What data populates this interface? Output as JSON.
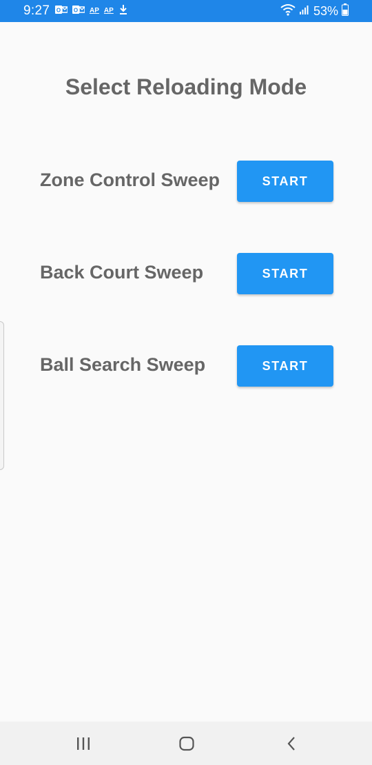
{
  "status_bar": {
    "time": "9:27",
    "notification_icons": [
      "outlook-icon",
      "outlook-icon",
      "ap-icon",
      "ap-icon",
      "download-icon"
    ],
    "ap_label": "AP",
    "battery_percent": "53%",
    "color": "#1f86e8"
  },
  "page": {
    "title": "Select Reloading Mode"
  },
  "modes": [
    {
      "label": "Zone Control Sweep",
      "button": "START"
    },
    {
      "label": "Back Court Sweep",
      "button": "START"
    },
    {
      "label": "Ball Search Sweep",
      "button": "START"
    }
  ],
  "colors": {
    "accent": "#2196f3",
    "text": "#666666",
    "background": "#fafafa"
  },
  "nav_bar": {
    "icons": [
      "recent-apps-icon",
      "home-icon",
      "back-icon"
    ]
  }
}
